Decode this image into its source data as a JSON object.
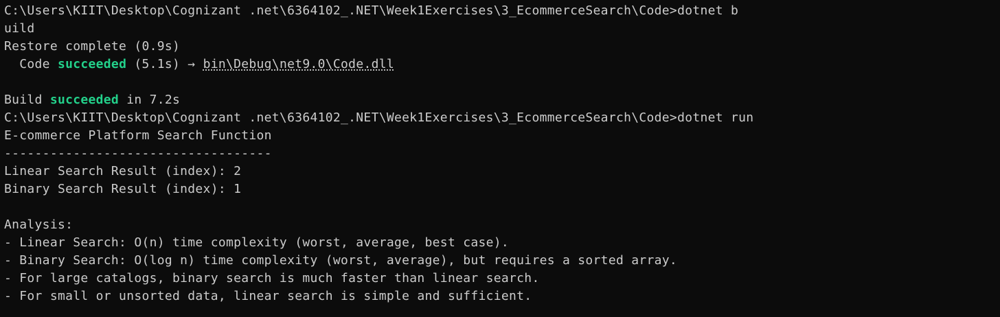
{
  "terminal": {
    "prompt1_path": "C:\\Users\\KIIT\\Desktop\\Cognizant .net\\6364102_.NET\\Week1Exercises\\3_EcommerceSearch\\Code>",
    "prompt1_cmd_part1": "dotnet b",
    "prompt1_cmd_part2": "uild",
    "restore": "Restore complete (0.9s)",
    "project_indent": "  Code ",
    "project_status": "succeeded",
    "project_time": " (5.1s) → ",
    "project_output": "bin\\Debug\\net9.0\\Code.dll",
    "build_prefix": "Build ",
    "build_status": "succeeded",
    "build_suffix": " in 7.2s",
    "prompt2_path": "C:\\Users\\KIIT\\Desktop\\Cognizant .net\\6364102_.NET\\Week1Exercises\\3_EcommerceSearch\\Code>",
    "prompt2_cmd": "dotnet run",
    "app_title": "E-commerce Platform Search Function",
    "separator": "-----------------------------------",
    "linear_result": "Linear Search Result (index): 2",
    "binary_result": "Binary Search Result (index): 1",
    "analysis_heading": "Analysis:",
    "analysis_items": [
      "- Linear Search: O(n) time complexity (worst, average, best case).",
      "- Binary Search: O(log n) time complexity (worst, average), but requires a sorted array.",
      "- For large catalogs, binary search is much faster than linear search.",
      "- For small or unsorted data, linear search is simple and sufficient."
    ]
  },
  "colors": {
    "background": "#0c0c0c",
    "foreground": "#cccccc",
    "success": "#23d18b"
  }
}
